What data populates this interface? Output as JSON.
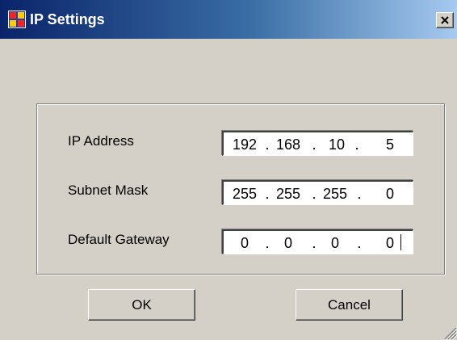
{
  "window": {
    "title": "IP Settings",
    "icon": "app-window-icon"
  },
  "fields": [
    {
      "label": "IP Address",
      "octets": [
        "192",
        "168",
        "10",
        "5"
      ]
    },
    {
      "label": "Subnet Mask",
      "octets": [
        "255",
        "255",
        "255",
        "0"
      ]
    },
    {
      "label": "Default Gateway",
      "octets": [
        "0",
        "0",
        "0",
        "0"
      ]
    }
  ],
  "separator": ".",
  "buttons": {
    "ok_label": "OK",
    "cancel_label": "Cancel"
  },
  "colors": {
    "dialog_bg": "#d4d0c8",
    "title_gradient_start": "#0a246a",
    "title_gradient_end": "#a6caf0"
  }
}
